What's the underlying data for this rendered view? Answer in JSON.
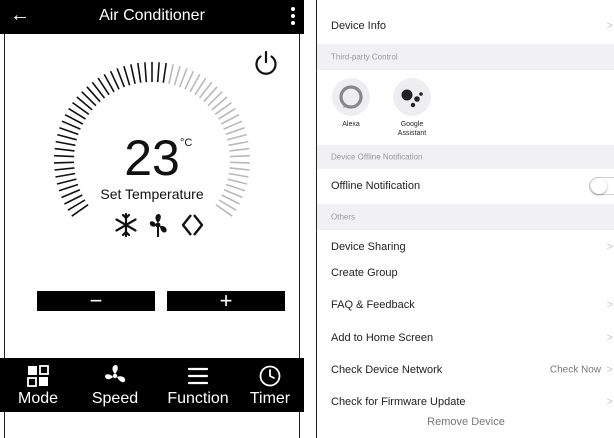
{
  "ac": {
    "title": "Air Conditioner",
    "back_glyph": "←",
    "temperature": "23",
    "unit": "°C",
    "set_label": "Set Temperature",
    "minus_label": "−",
    "plus_label": "+",
    "tabs": [
      {
        "label": "Mode",
        "icon": "mode-icon"
      },
      {
        "label": "Speed",
        "icon": "fan-icon"
      },
      {
        "label": "Function",
        "icon": "menu-icon"
      },
      {
        "label": "Timer",
        "icon": "clock-icon"
      }
    ],
    "status_icons": [
      "snowflake-icon",
      "fan-icon",
      "auto-swing-icon"
    ]
  },
  "settings": {
    "device_info": "Device Info",
    "section_third_party": "Third-party Control",
    "alexa": "Alexa",
    "google_line1": "Google",
    "google_line2": "Assistant",
    "section_offline": "Device Offline Notification",
    "offline_notification": "Offline Notification",
    "offline_enabled": false,
    "section_others": "Others",
    "device_sharing": "Device Sharing",
    "create_group": "Create Group",
    "faq": "FAQ & Feedback",
    "add_home": "Add to Home Screen",
    "check_network": "Check Device Network",
    "check_now": "Check Now",
    "firmware": "Check for Firmware Update",
    "remove": "Remove Device",
    "chevron": ">"
  }
}
